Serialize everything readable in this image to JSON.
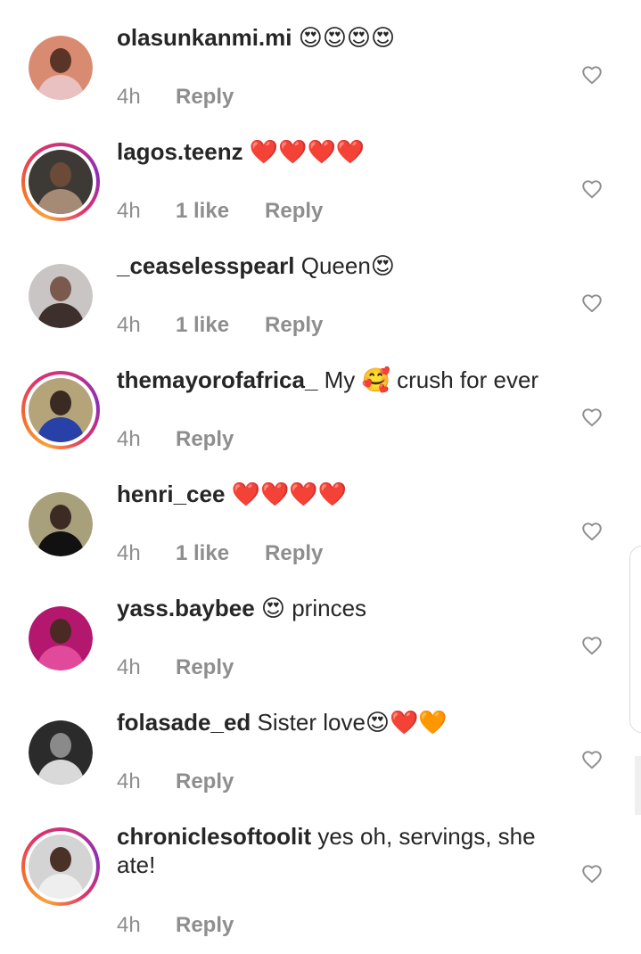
{
  "comments": [
    {
      "username": "olasunkanmi.mi",
      "text": " 😍😍😍😍",
      "time": "4h",
      "likes": "",
      "reply": "Reply",
      "story_ring": false,
      "avatar_colors": {
        "bg": "#d98b72",
        "head": "#5a3527",
        "body": "#e8c1c0"
      },
      "like_icon": "heart-outline-icon"
    },
    {
      "username": "lagos.teenz",
      "text": " ❤️❤️❤️❤️",
      "time": "4h",
      "likes": "1 like",
      "reply": "Reply",
      "story_ring": true,
      "avatar_colors": {
        "bg": "#3d3a36",
        "head": "#6b4a38",
        "body": "#a58a76"
      },
      "like_icon": "heart-outline-icon"
    },
    {
      "username": "_ceaselesspearl",
      "text": " Queen😍",
      "time": "4h",
      "likes": "1 like",
      "reply": "Reply",
      "story_ring": false,
      "avatar_colors": {
        "bg": "#c9c5c4",
        "head": "#7b5a4d",
        "body": "#3c2f2c"
      },
      "like_icon": "heart-outline-icon"
    },
    {
      "username": "themayorofafrica_",
      "text": " My 🥰 crush for ever",
      "time": "4h",
      "likes": "",
      "reply": "Reply",
      "story_ring": true,
      "avatar_colors": {
        "bg": "#b5a37a",
        "head": "#3a2a22",
        "body": "#2741a8"
      },
      "like_icon": "heart-outline-icon"
    },
    {
      "username": "henri_cee",
      "text": " ❤️❤️❤️❤️",
      "time": "4h",
      "likes": "1 like",
      "reply": "Reply",
      "story_ring": false,
      "avatar_colors": {
        "bg": "#a8a07a",
        "head": "#3b2b23",
        "body": "#111111"
      },
      "like_icon": "heart-outline-icon"
    },
    {
      "username": "yass.baybee",
      "text": " 😍 princes",
      "time": "4h",
      "likes": "",
      "reply": "Reply",
      "story_ring": false,
      "avatar_colors": {
        "bg": "#b3186e",
        "head": "#4a2a22",
        "body": "#e14a9a"
      },
      "like_icon": "heart-outline-icon"
    },
    {
      "username": "folasade_ed",
      "text": " Sister love😍❤️🧡",
      "time": "4h",
      "likes": "",
      "reply": "Reply",
      "story_ring": false,
      "avatar_colors": {
        "bg": "#2b2b2b",
        "head": "#8a8a8a",
        "body": "#d9d9d9"
      },
      "like_icon": "heart-outline-icon"
    },
    {
      "username": "chroniclesoftoolit",
      "text": " yes oh, servings, she ate!",
      "time": "4h",
      "likes": "",
      "reply": "Reply",
      "story_ring": true,
      "avatar_colors": {
        "bg": "#d4d4d4",
        "head": "#4a3128",
        "body": "#eeeeee"
      },
      "like_icon": "heart-outline-icon"
    }
  ]
}
